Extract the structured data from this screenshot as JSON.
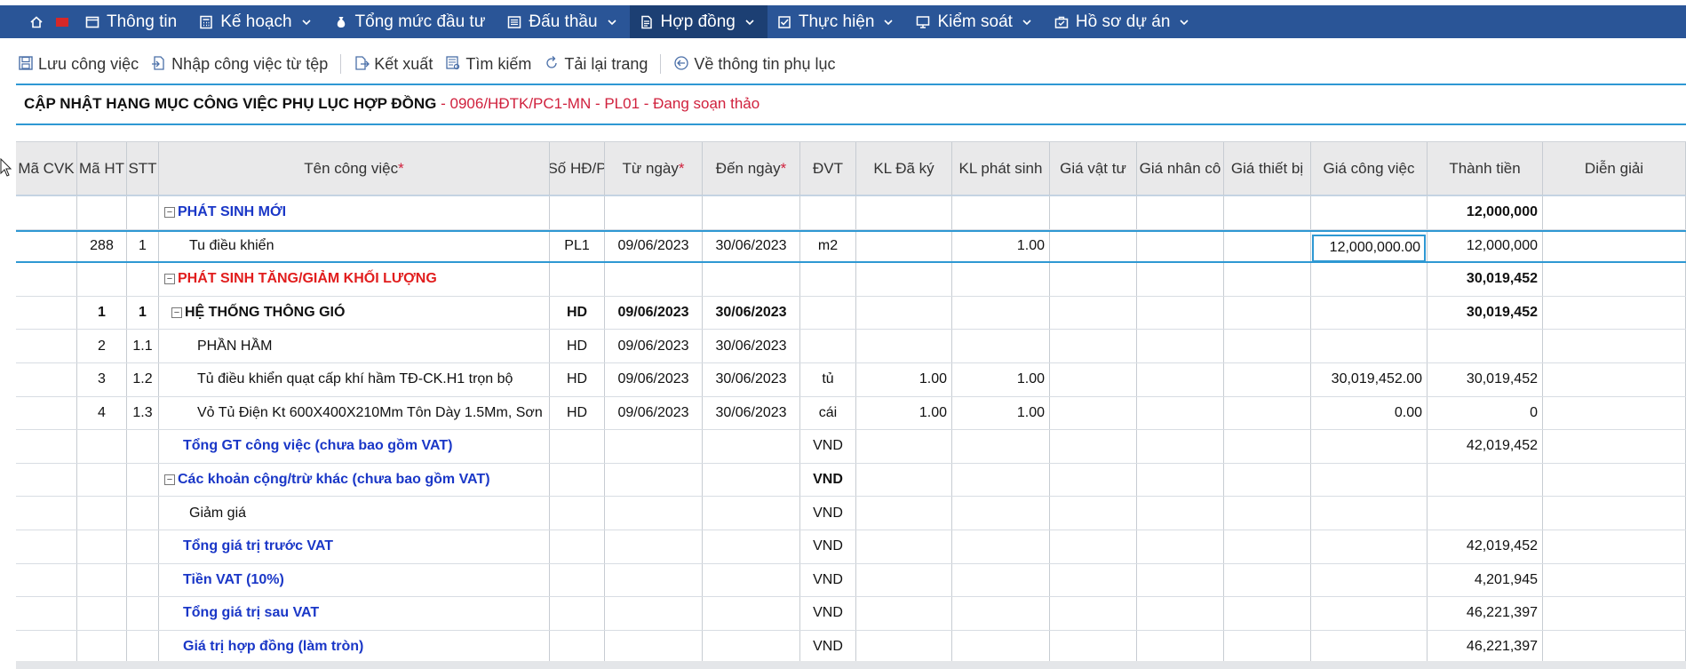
{
  "nav": {
    "items": [
      {
        "label": "Thông tin",
        "icon": "window-icon",
        "dropdown": false,
        "active": false
      },
      {
        "label": "Kế hoạch",
        "icon": "calculator-icon",
        "dropdown": true,
        "active": false
      },
      {
        "label": "Tổng mức đầu tư",
        "icon": "money-bag-icon",
        "dropdown": false,
        "active": false
      },
      {
        "label": "Đấu thầu",
        "icon": "list-icon",
        "dropdown": true,
        "active": false
      },
      {
        "label": "Hợp đồng",
        "icon": "document-icon",
        "dropdown": true,
        "active": true
      },
      {
        "label": "Thực hiện",
        "icon": "checkbox-icon",
        "dropdown": true,
        "active": false
      },
      {
        "label": "Kiểm soát",
        "icon": "monitor-icon",
        "dropdown": true,
        "active": false
      },
      {
        "label": "Hồ sơ dự án",
        "icon": "briefcase-icon",
        "dropdown": true,
        "active": false
      }
    ]
  },
  "toolbar": {
    "save": "Lưu công việc",
    "import": "Nhập công việc từ tệp",
    "export": "Kết xuất",
    "search": "Tìm kiếm",
    "reload": "Tải lại trang",
    "back": "Về thông tin phụ lục"
  },
  "page": {
    "title": "CẬP NHẬT HẠNG MỤC CÔNG VIỆC PHỤ LỤC HỢP ĐỒNG",
    "subtitle": " - 0906/HĐTK/PC1-MN - PL01 - Đang soạn thảo"
  },
  "table": {
    "columns": [
      {
        "label": "Mã CVK",
        "required": false
      },
      {
        "label": "Mã HT",
        "required": false
      },
      {
        "label": "STT",
        "required": false
      },
      {
        "label": "Tên công việc",
        "required": true
      },
      {
        "label": "Số HĐ/P",
        "required": false
      },
      {
        "label": "Từ ngày",
        "required": true
      },
      {
        "label": "Đến ngày",
        "required": true
      },
      {
        "label": "ĐVT",
        "required": false
      },
      {
        "label": "KL Đã ký",
        "required": false
      },
      {
        "label": "KL phát sinh",
        "required": false
      },
      {
        "label": "Giá vật tư",
        "required": false
      },
      {
        "label": "Giá nhân cô",
        "required": false
      },
      {
        "label": "Giá thiết bị",
        "required": false
      },
      {
        "label": "Giá công việc",
        "required": false
      },
      {
        "label": "Thành tiền",
        "required": false
      },
      {
        "label": "Diễn giải",
        "required": false
      }
    ],
    "rows": [
      {
        "style": "blue",
        "toggle": true,
        "indent": 6,
        "cells": [
          "",
          "",
          "",
          "PHÁT SINH MỚI",
          "",
          "",
          "",
          "",
          "",
          "",
          "",
          "",
          "",
          "",
          "12,000,000",
          ""
        ],
        "boldTotal": true
      },
      {
        "style": "normal",
        "toggle": false,
        "indent": 34,
        "selected": true,
        "cells": [
          "",
          "288",
          "1",
          "Tu điều khiển",
          "PL1",
          "09/06/2023",
          "30/06/2023",
          "m2",
          "",
          "1.00",
          "",
          "",
          "",
          "12,000,000.00",
          "12,000,000",
          ""
        ]
      },
      {
        "style": "red",
        "toggle": true,
        "indent": 6,
        "cells": [
          "",
          "",
          "",
          "PHÁT SINH TĂNG/GIẢM KHỐI LƯỢNG",
          "",
          "",
          "",
          "",
          "",
          "",
          "",
          "",
          "",
          "",
          "30,019,452",
          ""
        ],
        "boldTotal": true
      },
      {
        "style": "bold",
        "toggle": true,
        "indent": 14,
        "cells": [
          "",
          "1",
          "1",
          "HỆ THỐNG THÔNG GIÓ",
          "HD",
          "09/06/2023",
          "30/06/2023",
          "",
          "",
          "",
          "",
          "",
          "",
          "",
          "30,019,452",
          ""
        ],
        "boldTotal": true
      },
      {
        "style": "normal",
        "toggle": false,
        "indent": 43,
        "cells": [
          "",
          "2",
          "1.1",
          "PHẦN HẦM",
          "HD",
          "09/06/2023",
          "30/06/2023",
          "",
          "",
          "",
          "",
          "",
          "",
          "",
          "",
          ""
        ]
      },
      {
        "style": "normal",
        "toggle": false,
        "indent": 43,
        "cells": [
          "",
          "3",
          "1.2",
          "Tủ điều khiển quạt cấp khí hầm TĐ-CK.H1 trọn bộ",
          "HD",
          "09/06/2023",
          "30/06/2023",
          "tủ",
          "1.00",
          "1.00",
          "",
          "",
          "",
          "30,019,452.00",
          "30,019,452",
          ""
        ]
      },
      {
        "style": "normal",
        "toggle": false,
        "indent": 43,
        "cells": [
          "",
          "4",
          "1.3",
          "Vỏ Tủ Điện Kt 600X400X210Mm Tôn Dày 1.5Mm, Sơn",
          "HD",
          "09/06/2023",
          "30/06/2023",
          "cái",
          "1.00",
          "1.00",
          "",
          "",
          "",
          "0.00",
          "0",
          ""
        ]
      },
      {
        "style": "blue",
        "toggle": false,
        "indent": 27,
        "cells": [
          "",
          "",
          "",
          "Tổng GT công việc (chưa bao gồm VAT)",
          "",
          "",
          "",
          "VND",
          "",
          "",
          "",
          "",
          "",
          "",
          "42,019,452",
          ""
        ]
      },
      {
        "style": "blue",
        "toggle": true,
        "indent": 6,
        "cells": [
          "",
          "",
          "",
          "Các khoản cộng/trừ khác (chưa bao gồm VAT)",
          "",
          "",
          "",
          "VND",
          "",
          "",
          "",
          "",
          "",
          "",
          "",
          ""
        ],
        "boldUnit": true
      },
      {
        "style": "normal",
        "toggle": false,
        "indent": 34,
        "cells": [
          "",
          "",
          "",
          "Giảm giá",
          "",
          "",
          "",
          "VND",
          "",
          "",
          "",
          "",
          "",
          "",
          "",
          ""
        ]
      },
      {
        "style": "blue",
        "toggle": false,
        "indent": 27,
        "cells": [
          "",
          "",
          "",
          "Tổng giá trị trước VAT",
          "",
          "",
          "",
          "VND",
          "",
          "",
          "",
          "",
          "",
          "",
          "42,019,452",
          ""
        ]
      },
      {
        "style": "blue",
        "toggle": false,
        "indent": 27,
        "cells": [
          "",
          "",
          "",
          "Tiền VAT (10%)",
          "",
          "",
          "",
          "VND",
          "",
          "",
          "",
          "",
          "",
          "",
          "4,201,945",
          ""
        ]
      },
      {
        "style": "blue",
        "toggle": false,
        "indent": 27,
        "cells": [
          "",
          "",
          "",
          "Tổng giá trị sau VAT",
          "",
          "",
          "",
          "VND",
          "",
          "",
          "",
          "",
          "",
          "",
          "46,221,397",
          ""
        ]
      },
      {
        "style": "blue",
        "toggle": false,
        "indent": 27,
        "cells": [
          "",
          "",
          "",
          "Giá trị hợp đồng (làm tròn)",
          "",
          "",
          "",
          "VND",
          "",
          "",
          "",
          "",
          "",
          "",
          "46,221,397",
          ""
        ]
      }
    ]
  }
}
